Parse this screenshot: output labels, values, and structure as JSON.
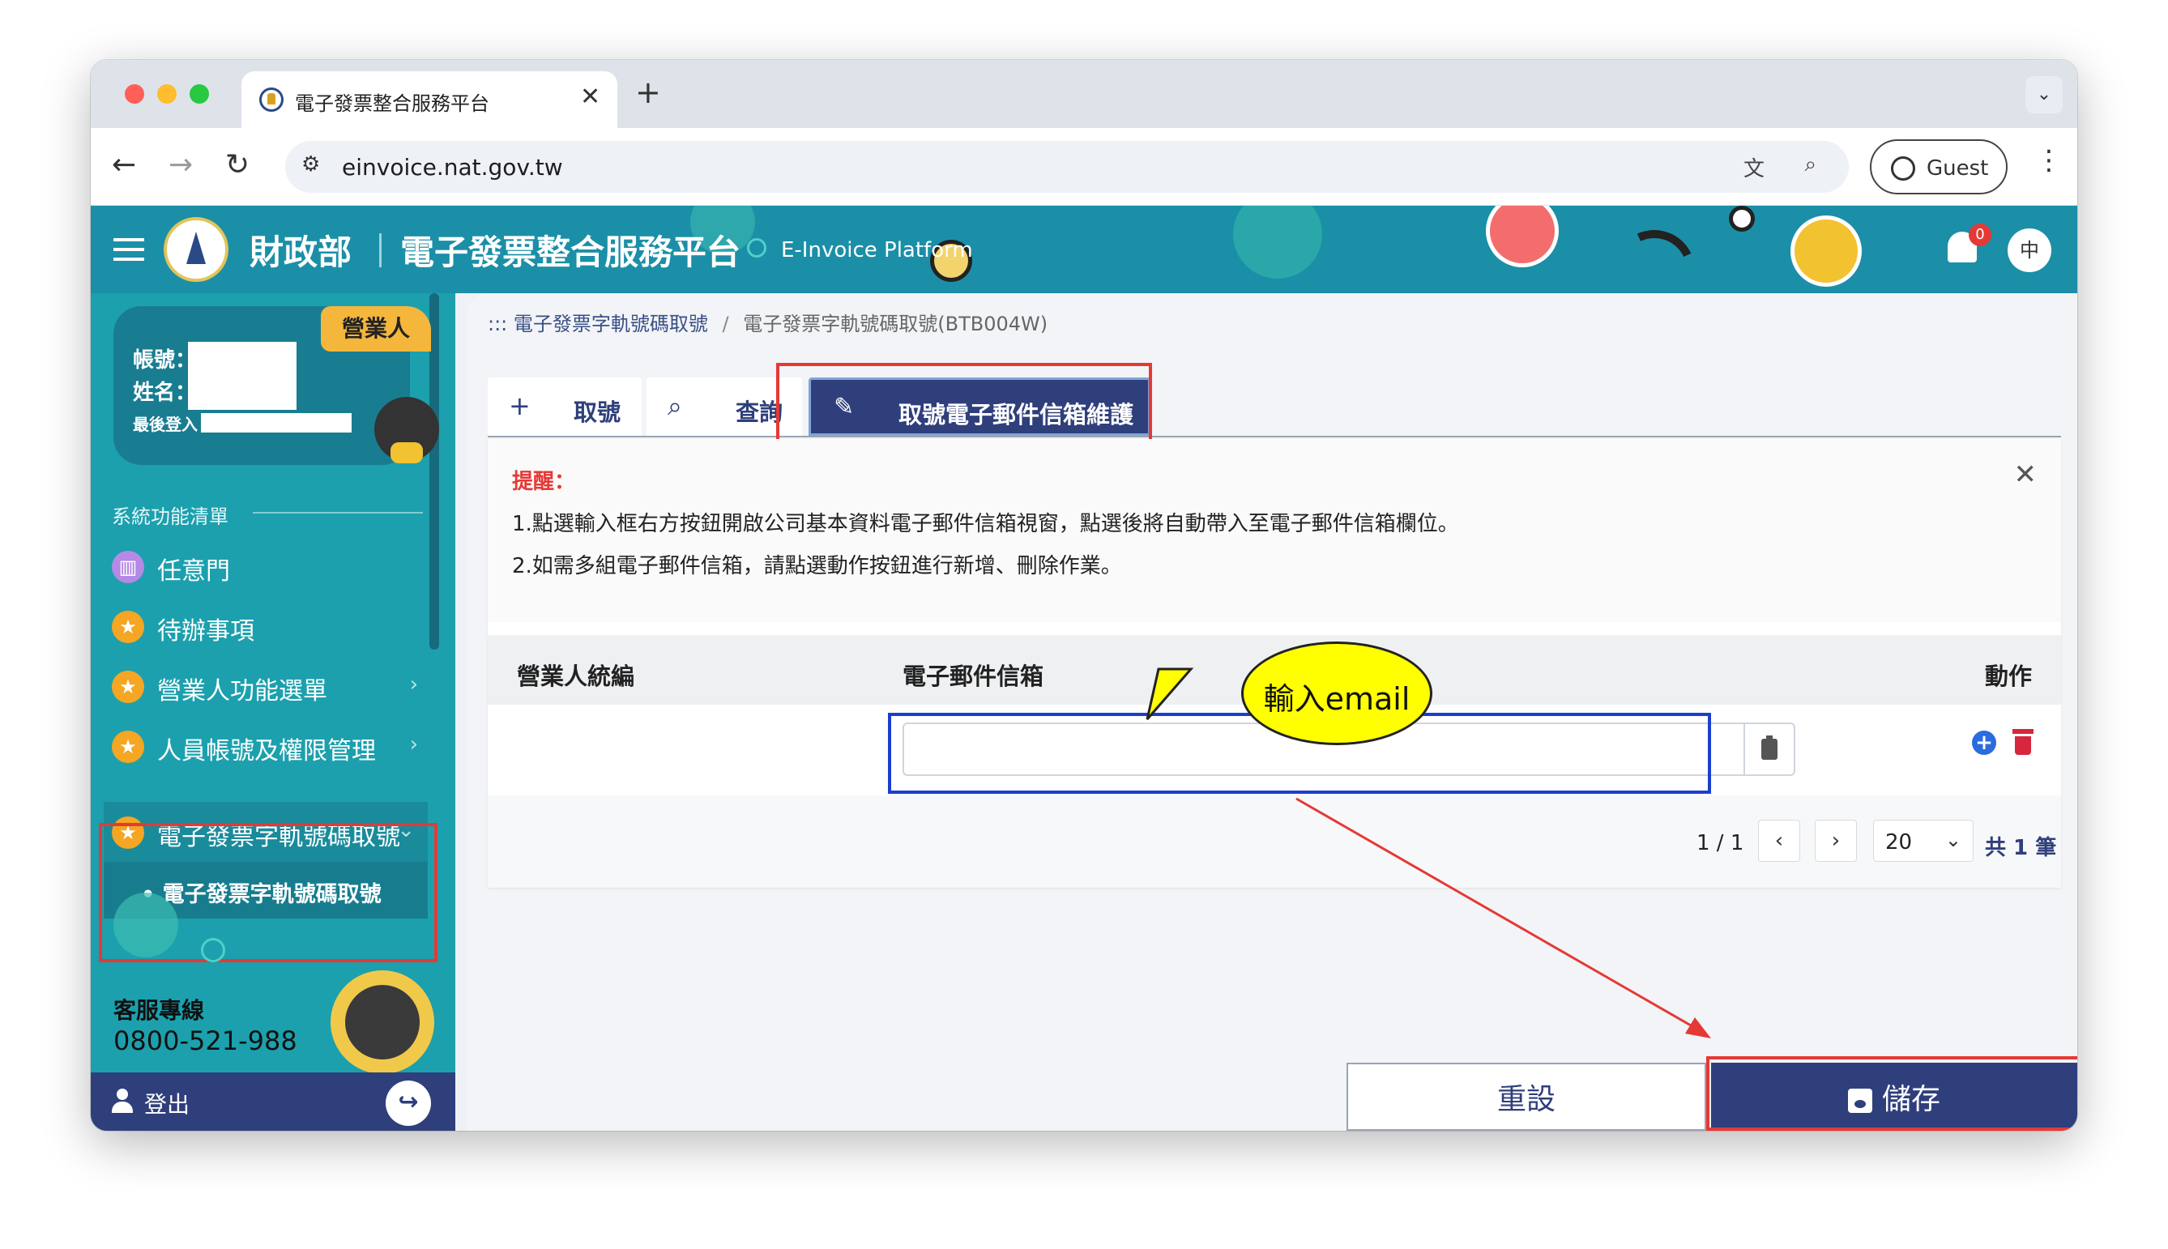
{
  "browser": {
    "tab_title": "電子發票整合服務平台",
    "tab_close": "✕",
    "new_tab": "+",
    "url": "einvoice.nat.gov.tw",
    "profile_label": "Guest",
    "back_glyph": "←",
    "forward_glyph": "→",
    "reload_glyph": "↻",
    "menu_glyph": "⋮",
    "tab_menu_glyph": "⌄"
  },
  "header": {
    "ministry": "財政部",
    "platform": "電子發票整合服務平台",
    "platform_en": "E-Invoice Platform",
    "notification_count": "0",
    "lang": "中"
  },
  "sidebar": {
    "role_tag": "營業人",
    "account_label": "帳號：",
    "name_label": "姓名：",
    "last_login_label": "最後登入",
    "section_title": "系統功能清單",
    "section_toggle": "—",
    "items": [
      {
        "label": "任意門",
        "icon": "map-icon"
      },
      {
        "label": "待辦事項",
        "icon": "star-icon"
      },
      {
        "label": "營業人功能選單",
        "icon": "star-icon",
        "chevron": "›"
      },
      {
        "label": "人員帳號及權限管理",
        "icon": "star-icon",
        "chevron": "›"
      },
      {
        "label": "電子發票字軌號碼取號",
        "icon": "star-icon",
        "chevron": "⌄"
      }
    ],
    "sub_item": "電子發票字軌號碼取號",
    "hotline_label": "客服專線",
    "hotline_number": "0800-521-988",
    "logout_label": "登出",
    "logout_glyph": "↪"
  },
  "main": {
    "breadcrumb": {
      "prefix": ":::",
      "parent": "電子發票字軌號碼取號",
      "separator": "/",
      "current": "電子發票字軌號碼取號(BTB004W)"
    },
    "tabs": [
      {
        "label": "取號",
        "icon": "plus-icon",
        "glyph": "+"
      },
      {
        "label": "查詢",
        "icon": "search-icon",
        "glyph": "⌕"
      },
      {
        "label": "取號電子郵件信箱維護",
        "icon": "edit-icon",
        "glyph": "✎"
      }
    ],
    "notice": {
      "title": "提醒：",
      "line1": "1.點選輸入框右方按鈕開啟公司基本資料電子郵件信箱視窗，點選後將自動帶入至電子郵件信箱欄位。",
      "line2": "2.如需多組電子郵件信箱，請點選動作按鈕進行新增、刪除作業。",
      "close_glyph": "✕"
    },
    "table": {
      "headers": {
        "business_id": "營業人統編",
        "email": "電子郵件信箱",
        "action": "動作"
      },
      "rows": [
        {
          "business_id": "",
          "email": ""
        }
      ],
      "add_glyph": "+"
    },
    "pagination": {
      "page_info": "1 / 1",
      "prev": "‹",
      "next": "›",
      "page_size": "20",
      "page_size_chevron": "⌄",
      "total": "共 1 筆"
    },
    "callout": "輸入email",
    "buttons": {
      "reset": "重設",
      "save": "儲存"
    }
  },
  "colors": {
    "header_teal": "#1b8fa7",
    "sidebar_teal": "#1ca0ad",
    "navy": "#2f3f7c",
    "highlight_red": "#e53935",
    "highlight_blue": "#1a3fcf",
    "callout_yellow": "#ffff00"
  }
}
